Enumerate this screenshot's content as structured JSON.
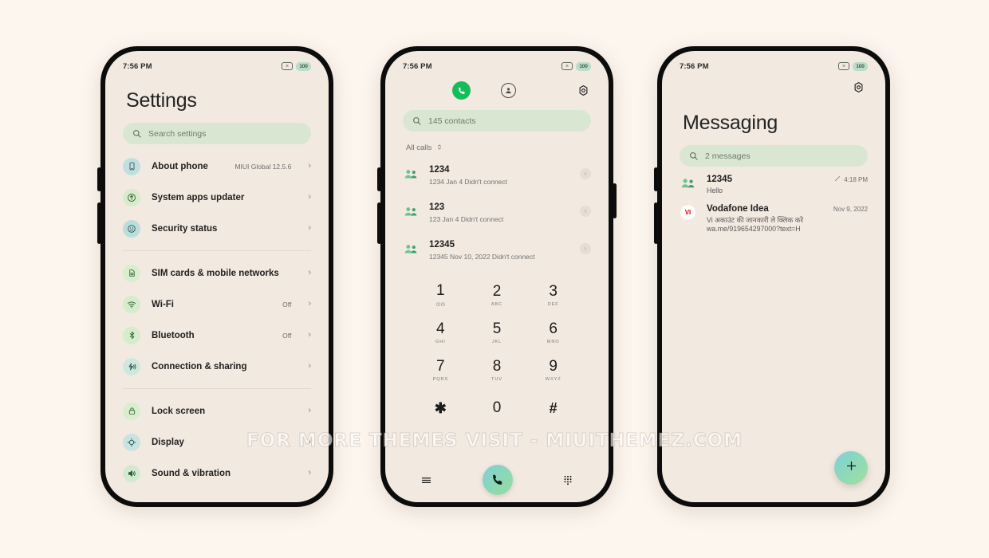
{
  "colors": {
    "page_bg": "#fdf6ef",
    "screen_bg": "#f2e9e0",
    "frame": "#0c0c0c",
    "search_bg": "#d9e7d2",
    "accent_green": "#14bd5a",
    "gradient_a": "#7fd0d8",
    "gradient_b": "#97dd9a"
  },
  "watermark": "FOR MORE THEMES VISIT - MIUITHEMEZ.COM",
  "status_bar": {
    "time": "7:56 PM",
    "battery": "100",
    "mute_icon": "mute-icon",
    "battery_icon": "battery-icon"
  },
  "settings": {
    "title": "Settings",
    "search": {
      "icon": "search-icon",
      "placeholder": "Search settings"
    },
    "groups": [
      {
        "items": [
          {
            "icon": "phone-info-icon",
            "label": "About phone",
            "value": "MIUI Global 12.5.6",
            "chevron": "›",
            "swatch": "#bfe0de"
          },
          {
            "icon": "update-icon",
            "label": "System apps updater",
            "value": "",
            "chevron": "›",
            "swatch": "#d6eccb"
          },
          {
            "icon": "security-icon",
            "label": "Security status",
            "value": "",
            "chevron": "›",
            "swatch": "#b9dfda"
          }
        ]
      },
      {
        "items": [
          {
            "icon": "sim-card-icon",
            "label": "SIM cards & mobile networks",
            "value": "",
            "chevron": "›",
            "swatch": "#d9eecd"
          },
          {
            "icon": "wifi-icon",
            "label": "Wi-Fi",
            "value": "Off",
            "chevron": "›",
            "swatch": "#d6eccb"
          },
          {
            "icon": "bluetooth-icon",
            "label": "Bluetooth",
            "value": "Off",
            "chevron": "›",
            "swatch": "#d6eccb"
          },
          {
            "icon": "connection-sharing-icon",
            "label": "Connection & sharing",
            "value": "",
            "chevron": "›",
            "swatch": "#cfe8dd"
          }
        ]
      },
      {
        "items": [
          {
            "icon": "lock-icon",
            "label": "Lock screen",
            "value": "",
            "chevron": "›",
            "swatch": "#d9eecd"
          },
          {
            "icon": "display-icon",
            "label": "Display",
            "value": "",
            "chevron": "›",
            "swatch": "#c6e4e2"
          },
          {
            "icon": "sound-icon",
            "label": "Sound & vibration",
            "value": "",
            "chevron": "›",
            "swatch": "#d2ead0"
          }
        ]
      }
    ]
  },
  "dialer": {
    "tabs": {
      "phone_icon": "phone-icon",
      "contacts_icon": "contacts-person-icon",
      "settings_icon": "gear-icon"
    },
    "search": {
      "icon": "search-icon",
      "placeholder": "145 contacts"
    },
    "filter": {
      "label": "All calls",
      "icon": "sort-toggle-icon"
    },
    "calls": [
      {
        "avatar": "contacts-group-icon",
        "name": "1234",
        "sub": "1234  Jan 4 Didn't connect",
        "chevron": "›"
      },
      {
        "avatar": "contacts-group-icon",
        "name": "123",
        "sub": "123  Jan 4 Didn't connect",
        "chevron": "›"
      },
      {
        "avatar": "contacts-group-icon",
        "name": "12345",
        "sub": "12345  Nov 10, 2022 Didn't connect",
        "chevron": "›"
      }
    ],
    "keypad": [
      {
        "digit": "1",
        "letters": "⊙⊙"
      },
      {
        "digit": "2",
        "letters": "ABC"
      },
      {
        "digit": "3",
        "letters": "DEF"
      },
      {
        "digit": "4",
        "letters": "GHI"
      },
      {
        "digit": "5",
        "letters": "JKL"
      },
      {
        "digit": "6",
        "letters": "MNO"
      },
      {
        "digit": "7",
        "letters": "PQRS"
      },
      {
        "digit": "8",
        "letters": "TUV"
      },
      {
        "digit": "9",
        "letters": "WXYZ"
      },
      {
        "digit": "✱",
        "letters": ""
      },
      {
        "digit": "0",
        "letters": "+"
      },
      {
        "digit": "#",
        "letters": ""
      }
    ],
    "nav": {
      "menu_icon": "menu-icon",
      "call_icon": "call-button-icon",
      "keypad_icon": "keypad-icon"
    }
  },
  "messaging": {
    "title": "Messaging",
    "settings_icon": "gear-icon",
    "search": {
      "icon": "search-icon",
      "placeholder": "2 messages"
    },
    "threads": [
      {
        "avatar": "contacts-group-icon",
        "name": "12345",
        "time": "4:18 PM",
        "time_icon": "pencil-icon",
        "body": "Hello"
      },
      {
        "avatar": "vi-logo-icon",
        "avatar_text": "VI",
        "name": "Vodafone Idea",
        "time": "Nov 9, 2022",
        "time_icon": "",
        "body": "Vi अकाउंट की जानकारी ले क्लिक करे wa.me/919654297000?text=H"
      }
    ],
    "fab": {
      "icon": "plus-icon"
    }
  }
}
